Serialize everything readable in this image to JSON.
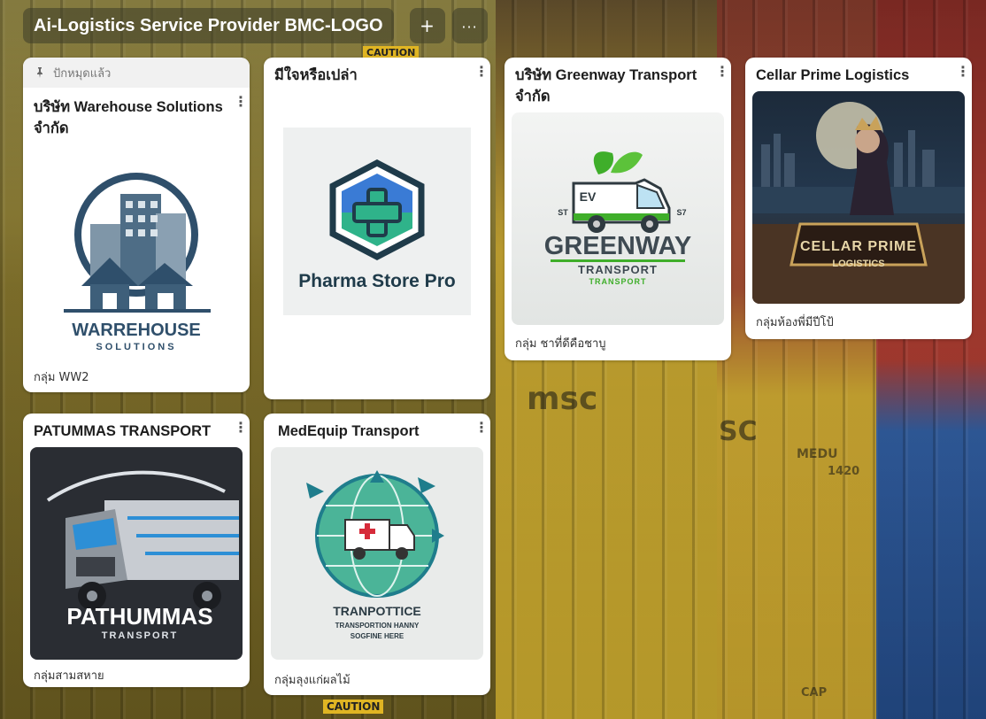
{
  "header": {
    "title": "Ai-Logistics Service Provider BMC-LOGO",
    "add_icon": "plus-icon",
    "more_icon": "ellipsis-icon"
  },
  "background": {
    "texts": [
      "CAUTION",
      "msc",
      "SC",
      "MEDU",
      "1420",
      "CAP",
      "CAUTION"
    ]
  },
  "cards": [
    {
      "pinned_label": "ปักหมุดแล้ว",
      "title": "บริษัท Warehouse Solutions จำกัด",
      "caption": "กลุ่ม WW2",
      "logo_text": [
        "WARREHOUSE",
        "SOLUTIONS"
      ],
      "colors": {
        "primary": "#2f4f6b",
        "accent": "#4e7a9a"
      }
    },
    {
      "title": "มีใจหรือเปล่า",
      "caption": "",
      "logo_text": [
        "Pharma Store Pro"
      ],
      "colors": {
        "primary": "#1f3b4a",
        "accent": "#2fb38a",
        "accent2": "#3a7bd5"
      }
    },
    {
      "title": "บริษัท Greenway Transport จำกัด",
      "caption": "กลุ่ม ชาที่ดีคือชาบู",
      "logo_text": [
        "GREENWAY",
        "TRANSPORT",
        "TRANSPORT",
        "EV",
        "ST",
        "S7"
      ],
      "colors": {
        "primary": "#3e4a52",
        "accent": "#3fae2a"
      }
    },
    {
      "title": "Cellar Prime Logistics",
      "caption": "กลุ่มห้องพี่มีปีโป้",
      "logo_text": [
        "CELLAR PRIME",
        "LOGISTICS"
      ],
      "colors": {
        "primary": "#1c2a3a",
        "accent": "#c9a25a"
      }
    },
    {
      "title": "PATUMMAS TRANSPORT",
      "caption": "กลุ่มสามสหาย",
      "logo_text": [
        "PATHUMMAS",
        "TRANSPORT"
      ],
      "colors": {
        "primary": "#2a2d33",
        "accent": "#2d8fd6"
      }
    },
    {
      "title": "MedEquip Transport",
      "caption": "กลุ่มลุงแก่ผลไม้",
      "logo_text": [
        "TRANPOTTICE",
        "TRANSPORTION HANNY",
        "SOGFINE HERE"
      ],
      "colors": {
        "primary": "#1f7d8c",
        "accent": "#d62b3a"
      }
    }
  ]
}
